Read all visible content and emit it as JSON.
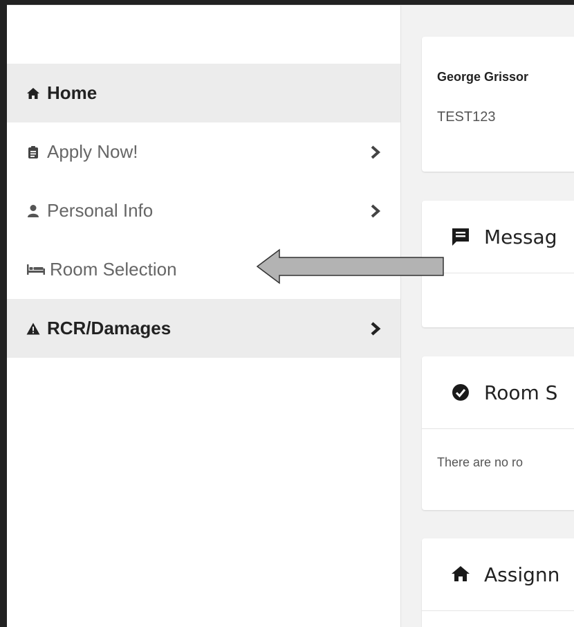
{
  "sidebar": {
    "items": [
      {
        "label": "Home",
        "icon": "home-icon"
      },
      {
        "label": "Apply Now!",
        "icon": "clipboard-icon"
      },
      {
        "label": "Personal Info",
        "icon": "user-icon"
      },
      {
        "label": "Room Selection",
        "icon": "bed-icon"
      },
      {
        "label": "RCR/Damages",
        "icon": "warning-icon"
      }
    ]
  },
  "main": {
    "user_card": {
      "name": "George Grissor",
      "id": "TEST123"
    },
    "messages": {
      "title": "Messag"
    },
    "room_status": {
      "title": "Room S",
      "body": "There are no ro"
    },
    "assignments": {
      "title": "Assignn"
    }
  },
  "colors": {
    "active_bg": "#ececec",
    "text": "#222222",
    "muted": "#666666",
    "arrow_fill": "#b3b3b3"
  }
}
